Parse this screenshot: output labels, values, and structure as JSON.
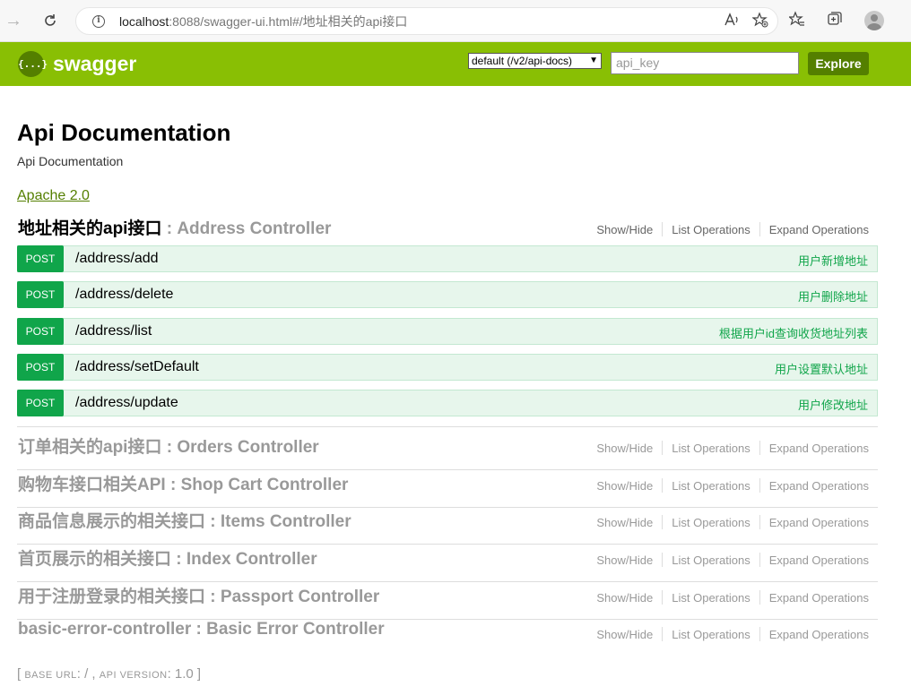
{
  "browser": {
    "url_host": "localhost",
    "url_rest": ":8088/swagger-ui.html#/地址相关的api接口"
  },
  "header": {
    "logo_glyph": "{...}",
    "logo_text": "swagger",
    "spec_select": "default (/v2/api-docs)",
    "api_key_placeholder": "api_key",
    "explore_label": "Explore"
  },
  "info": {
    "title": "Api Documentation",
    "description": "Api Documentation",
    "license": "Apache 2.0"
  },
  "ops_labels": {
    "show_hide": "Show/Hide",
    "list_operations": "List Operations",
    "expand_operations": "Expand Operations"
  },
  "resources": [
    {
      "zh": "地址相关的api接口",
      "name": " : Address Controller"
    },
    {
      "zh": "订单相关的api接口",
      "name": " : Orders Controller"
    },
    {
      "zh": "购物车接口相关API",
      "name": " : Shop Cart Controller"
    },
    {
      "zh": "商品信息展示的相关接口",
      "name": " : Items Controller"
    },
    {
      "zh": "首页展示的相关接口",
      "name": " : Index Controller"
    },
    {
      "zh": "用于注册登录的相关接口",
      "name": " : Passport Controller"
    },
    {
      "zh": "basic-error-controller",
      "name": " : Basic Error Controller"
    }
  ],
  "operations": [
    {
      "method": "POST",
      "path": "/address/add",
      "summary": "用户新增地址"
    },
    {
      "method": "POST",
      "path": "/address/delete",
      "summary": "用户删除地址"
    },
    {
      "method": "POST",
      "path": "/address/list",
      "summary": "根据用户id查询收货地址列表"
    },
    {
      "method": "POST",
      "path": "/address/setDefault",
      "summary": "用户设置默认地址"
    },
    {
      "method": "POST",
      "path": "/address/update",
      "summary": "用户修改地址"
    }
  ],
  "footer": {
    "open_bracket": "[ ",
    "base_url_label": "base url",
    "base_url_value": ": / , ",
    "api_version_label": "api version",
    "api_version_value": ": 1.0 ]"
  },
  "colors": {
    "header_green": "#89bf04",
    "dark_green": "#547f00",
    "post_green": "#10a54a",
    "post_bg": "#e7f6ec"
  }
}
